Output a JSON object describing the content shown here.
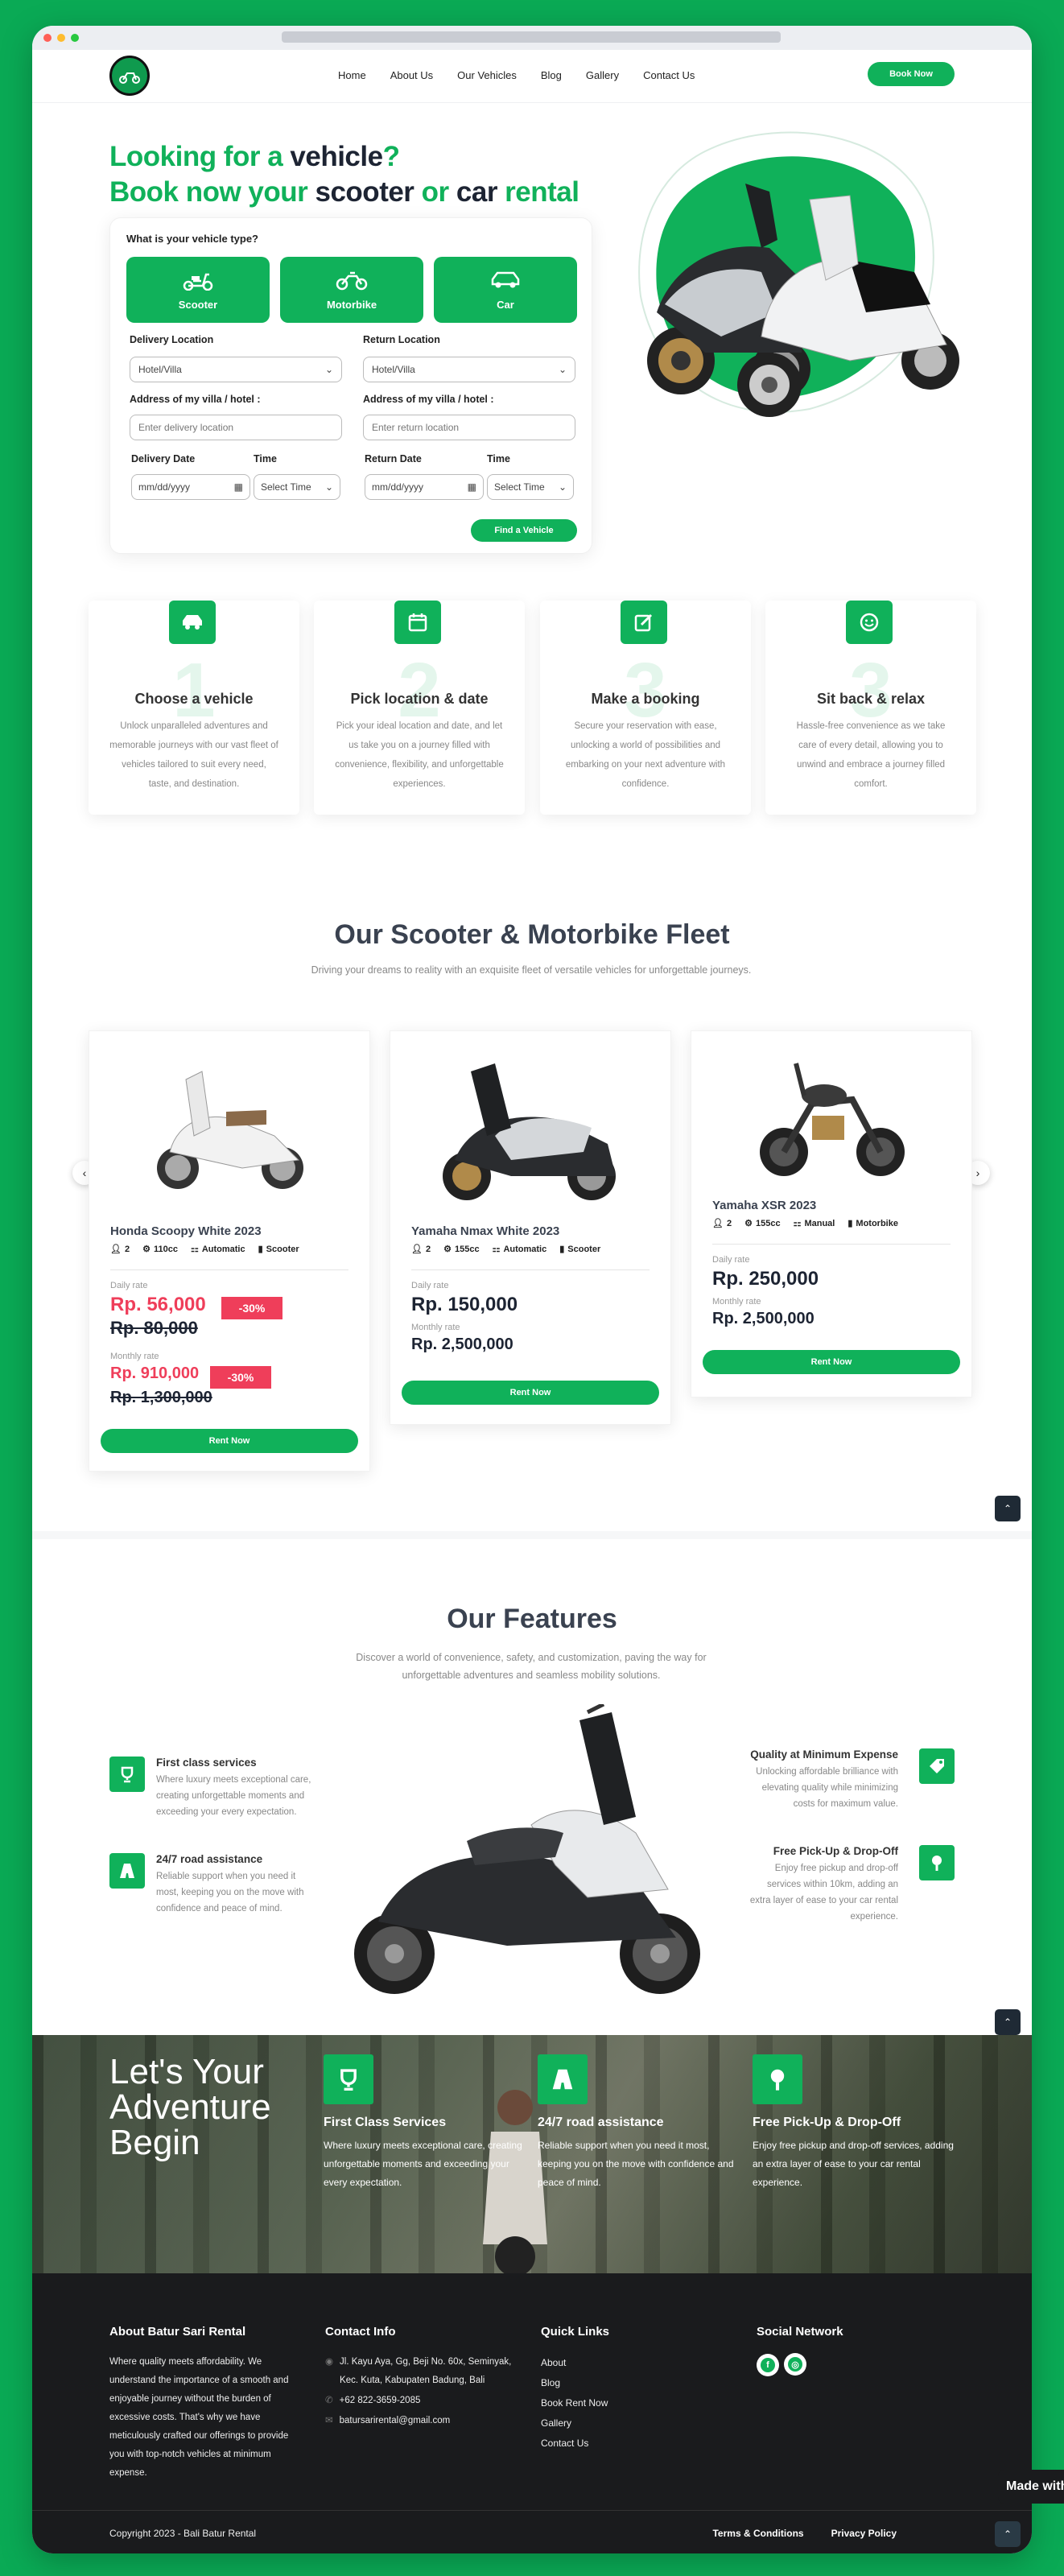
{
  "nav": {
    "items": [
      "Home",
      "About Us",
      "Our Vehicles",
      "Blog",
      "Gallery",
      "Contact Us"
    ],
    "cta": "Book Now"
  },
  "hero": {
    "line1_green": "Looking for a ",
    "line1_dark": "vehicle",
    "line1_end": "?",
    "line2_a": "Book now your ",
    "line2_b": "scooter",
    "line2_c": " or ",
    "line2_d": "car",
    "line2_e": " rental"
  },
  "form": {
    "question": "What is your vehicle type?",
    "types": [
      "Scooter",
      "Motorbike",
      "Car"
    ],
    "delivery_location_label": "Delivery Location",
    "return_location_label": "Return Location",
    "delivery_location_value": "Hotel/Villa",
    "return_location_value": "Hotel/Villa",
    "address_label": "Address of my villa / hotel :",
    "delivery_placeholder": "Enter delivery location",
    "return_placeholder": "Enter return location",
    "delivery_date_label": "Delivery Date",
    "return_date_label": "Return Date",
    "time_label": "Time",
    "date_placeholder": "mm/dd/yyyy",
    "time_value": "Select Time",
    "submit": "Find a Vehicle"
  },
  "steps": [
    {
      "num": "1",
      "title": "Choose a vehicle",
      "desc": "Unlock unparalleled adventures and memorable journeys with our vast fleet of vehicles tailored to suit every need, taste, and destination."
    },
    {
      "num": "2",
      "title": "Pick location & date",
      "desc": "Pick your ideal location and date, and let us take you on a journey filled with convenience, flexibility, and unforgettable experiences."
    },
    {
      "num": "3",
      "title": "Make a booking",
      "desc": "Secure your reservation with ease, unlocking a world of possibilities and embarking on your next adventure with confidence."
    },
    {
      "num": "3",
      "title": "Sit back & relax",
      "desc": "Hassle-free convenience as we take care of every detail, allowing you to unwind and embrace a journey filled comfort."
    }
  ],
  "fleet": {
    "title": "Our Scooter & Motorbike Fleet",
    "subtitle": "Driving your dreams to reality with an exquisite fleet of versatile vehicles for unforgettable journeys.",
    "daily_label": "Daily rate",
    "monthly_label": "Monthly rate",
    "rent_label": "Rent Now",
    "cards": [
      {
        "name": "Honda Scoopy White 2023",
        "seats": "2",
        "cc": "110cc",
        "trans": "Automatic",
        "type": "Scooter",
        "daily": "Rp. 56,000",
        "daily_old": "Rp. 80,000",
        "monthly": "Rp. 910,000",
        "monthly_old": "Rp. 1,300,000",
        "discount": "-30%"
      },
      {
        "name": "Yamaha Nmax White 2023",
        "seats": "2",
        "cc": "155cc",
        "trans": "Automatic",
        "type": "Scooter",
        "daily": "Rp. 150,000",
        "monthly": "Rp. 2,500,000"
      },
      {
        "name": "Yamaha XSR 2023",
        "seats": "2",
        "cc": "155cc",
        "trans": "Manual",
        "type": "Motorbike",
        "daily": "Rp. 250,000",
        "monthly": "Rp. 2,500,000"
      }
    ]
  },
  "features": {
    "title": "Our Features",
    "subtitle": "Discover a world of convenience, safety, and customization, paving the way for unforgettable adventures and seamless mobility solutions.",
    "items": [
      {
        "title": "First class services",
        "desc": "Where luxury meets exceptional care, creating unforgettable moments and exceeding your every expectation."
      },
      {
        "title": "24/7 road assistance",
        "desc": "Reliable support when you need it most, keeping you on the move with confidence and peace of mind."
      },
      {
        "title": "Quality at Minimum Expense",
        "desc": "Unlocking affordable brilliance with elevating quality while minimizing costs for maximum value."
      },
      {
        "title": "Free Pick-Up & Drop-Off",
        "desc": "Enjoy free pickup and drop-off services within 10km, adding an extra layer of ease to your car rental experience."
      }
    ]
  },
  "adventure": {
    "heading": "Let's Your Adventure Begin",
    "cols": [
      {
        "title": "First Class Services",
        "desc": "Where luxury meets exceptional care, creating unforgettable moments and exceeding your every expectation."
      },
      {
        "title": "24/7 road assistance",
        "desc": "Reliable support when you need it most, keeping you on the move with confidence and peace of mind."
      },
      {
        "title": "Free Pick-Up & Drop-Off",
        "desc": "Enjoy free pickup and drop-off services, adding an extra layer of ease to your car rental experience."
      }
    ]
  },
  "footer": {
    "about_title": "About Batur Sari Rental",
    "about_text": "Where quality meets affordability. We understand the importance of a smooth and enjoyable journey without the burden of excessive costs. That's why we have meticulously crafted our offerings to provide you with top-notch vehicles at minimum expense.",
    "contact_title": "Contact Info",
    "address": "Jl. Kayu Aya, Gg, Beji No. 60x, Seminyak, Kec. Kuta, Kabupaten Badung, Bali",
    "phone": "+62 822-3659-2085",
    "email": "batursarirental@gmail.com",
    "links_title": "Quick Links",
    "links": [
      "About",
      "Blog",
      "Book Rent Now",
      "Gallery",
      "Contact Us"
    ],
    "social_title": "Social Network",
    "copyright": "Copyright 2023 - Bali Batur Rental",
    "terms": "Terms & Conditions",
    "privacy": "Privacy Policy"
  },
  "made_with": "Made with",
  "colors": {
    "brand": "#10b15a",
    "discount": "#ef3e5a",
    "dark": "#1a1b1d"
  }
}
